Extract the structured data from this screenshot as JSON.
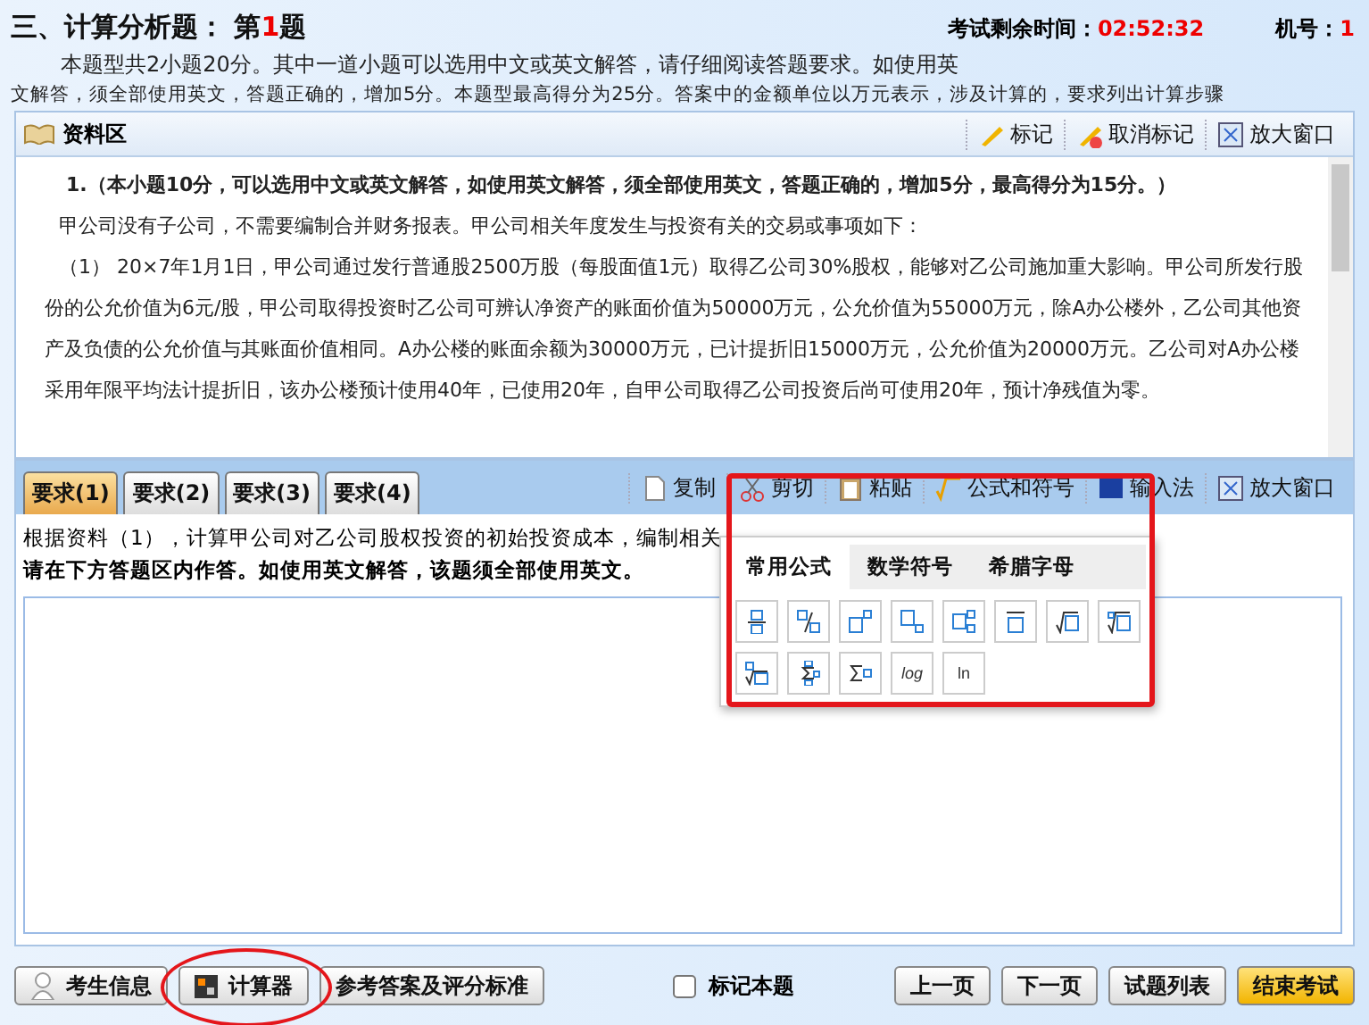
{
  "header": {
    "section": "三、计算分析题：",
    "question_prefix": "第",
    "question_number": "1",
    "question_suffix": "题",
    "timer_label": "考试剩余时间：",
    "timer_value": "02:52:32",
    "machine_label": "机号：",
    "machine_value": "1",
    "intro": [
      "本题型共2小题20分。其中一道小题可以选用中文或英文解答，请仔细阅读答题要求。如使用英",
      "文解答，须全部使用英文，答题正确的，增加5分。本题型最高得分为25分。答案中的金额单位以万元表示，涉及计算的，要求列出计算步骤"
    ]
  },
  "material": {
    "title": "资料区",
    "tools": [
      {
        "kind": "mark",
        "label": "标记"
      },
      {
        "kind": "unmark",
        "label": "取消标记"
      },
      {
        "kind": "maximize",
        "label": "放大窗口"
      }
    ],
    "paragraphs": [
      {
        "kind": "heading",
        "text": "1.（本小题10分，可以选用中文或英文解答，如使用英文解答，须全部使用英文，答题正确的，增加5分，最高得分为15分。）"
      },
      {
        "kind": "body",
        "text": "甲公司没有子公司，不需要编制合并财务报表。甲公司相关年度发生与投资有关的交易或事项如下："
      },
      {
        "kind": "body",
        "text": "（1） 20×7年1月1日，甲公司通过发行普通股2500万股（每股面值1元）取得乙公司30%股权，能够对乙公司施加重大影响。甲公司所发行股份的公允价值为6元/股，甲公司取得投资时乙公司可辨认净资产的账面价值为50000万元，公允价值为55000万元，除A办公楼外，乙公司其他资产及负债的公允价值与其账面价值相同。A办公楼的账面余额为30000万元，已计提折旧15000万元，公允价值为20000万元。乙公司对A办公楼采用年限平均法计提折旧，该办公楼预计使用40年，已使用20年，自甲公司取得乙公司投资后尚可使用20年，预计净残值为零。"
      }
    ]
  },
  "requirements": {
    "tabs": [
      {
        "label": "要求(1)",
        "selected": true
      },
      {
        "label": "要求(2)",
        "selected": false
      },
      {
        "label": "要求(3)",
        "selected": false
      },
      {
        "label": "要求(4)",
        "selected": false
      }
    ],
    "tools": [
      {
        "kind": "copy",
        "label": "复制"
      },
      {
        "kind": "cut",
        "label": "剪切"
      },
      {
        "kind": "paste",
        "label": "粘贴"
      },
      {
        "kind": "formula",
        "label": "公式和符号"
      },
      {
        "kind": "ime",
        "label": "输入法"
      },
      {
        "kind": "maximize",
        "label": "放大窗口"
      }
    ],
    "question": "根据资料（1），计算甲公司对乙公司股权投资的初始投资成本，编制相关",
    "instruction": "请在下方答题区内作答。如使用英文解答，该题须全部使用英文。"
  },
  "formula_popup": {
    "tabs": [
      {
        "label": "常用公式",
        "selected": true
      },
      {
        "label": "数学符号",
        "selected": false
      },
      {
        "label": "希腊字母",
        "selected": false
      }
    ],
    "items": [
      {
        "kind": "fraction"
      },
      {
        "kind": "slash"
      },
      {
        "kind": "sup"
      },
      {
        "kind": "sub"
      },
      {
        "kind": "subsup"
      },
      {
        "kind": "overline"
      },
      {
        "kind": "sqrt"
      },
      {
        "kind": "root"
      },
      {
        "kind": "root2"
      },
      {
        "kind": "sumlimits"
      },
      {
        "kind": "sum"
      },
      {
        "kind": "log",
        "label": "log"
      },
      {
        "kind": "ln",
        "label": "ln"
      }
    ]
  },
  "footer": {
    "left_buttons": [
      {
        "kind": "user",
        "label": "考生信息"
      },
      {
        "kind": "calc",
        "label": "计算器"
      },
      {
        "kind": "plain",
        "label": "参考答案及评分标准"
      }
    ],
    "mark_checkbox": {
      "label": "标记本题",
      "checked": false
    },
    "right_buttons": [
      {
        "label": "上一页",
        "primary": false
      },
      {
        "label": "下一页",
        "primary": false
      },
      {
        "label": "试题列表",
        "primary": false
      },
      {
        "label": "结束考试",
        "primary": true
      }
    ]
  },
  "annotations": [
    {
      "kind": "rect"
    },
    {
      "kind": "ellipse"
    }
  ]
}
